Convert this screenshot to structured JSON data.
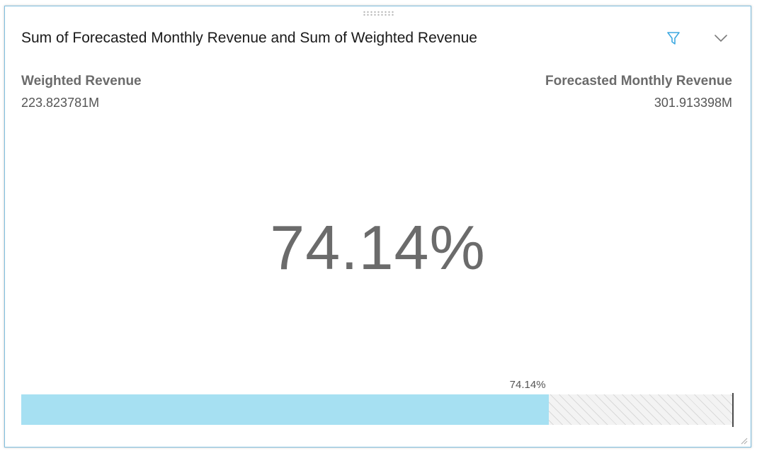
{
  "visual": {
    "title": "Sum of Forecasted Monthly Revenue and Sum of Weighted Revenue",
    "icons": {
      "filter": "filter-icon",
      "menu": "chevron-down-icon",
      "drag": "drag-handle-icon",
      "resize": "resize-grip-icon"
    }
  },
  "metrics": {
    "left_label": "Weighted Revenue",
    "left_value": "223.823781M",
    "right_label": "Forecasted Monthly Revenue",
    "right_value": "301.913398M"
  },
  "kpi": {
    "percent_text": "74.14%",
    "bar_label": "74.14%",
    "progress": 0.7414
  },
  "colors": {
    "accent": "#3fa9e0",
    "bar_fill": "#a6e0f2",
    "border": "#7fbfdf",
    "text_gray": "#6b6b6b"
  }
}
